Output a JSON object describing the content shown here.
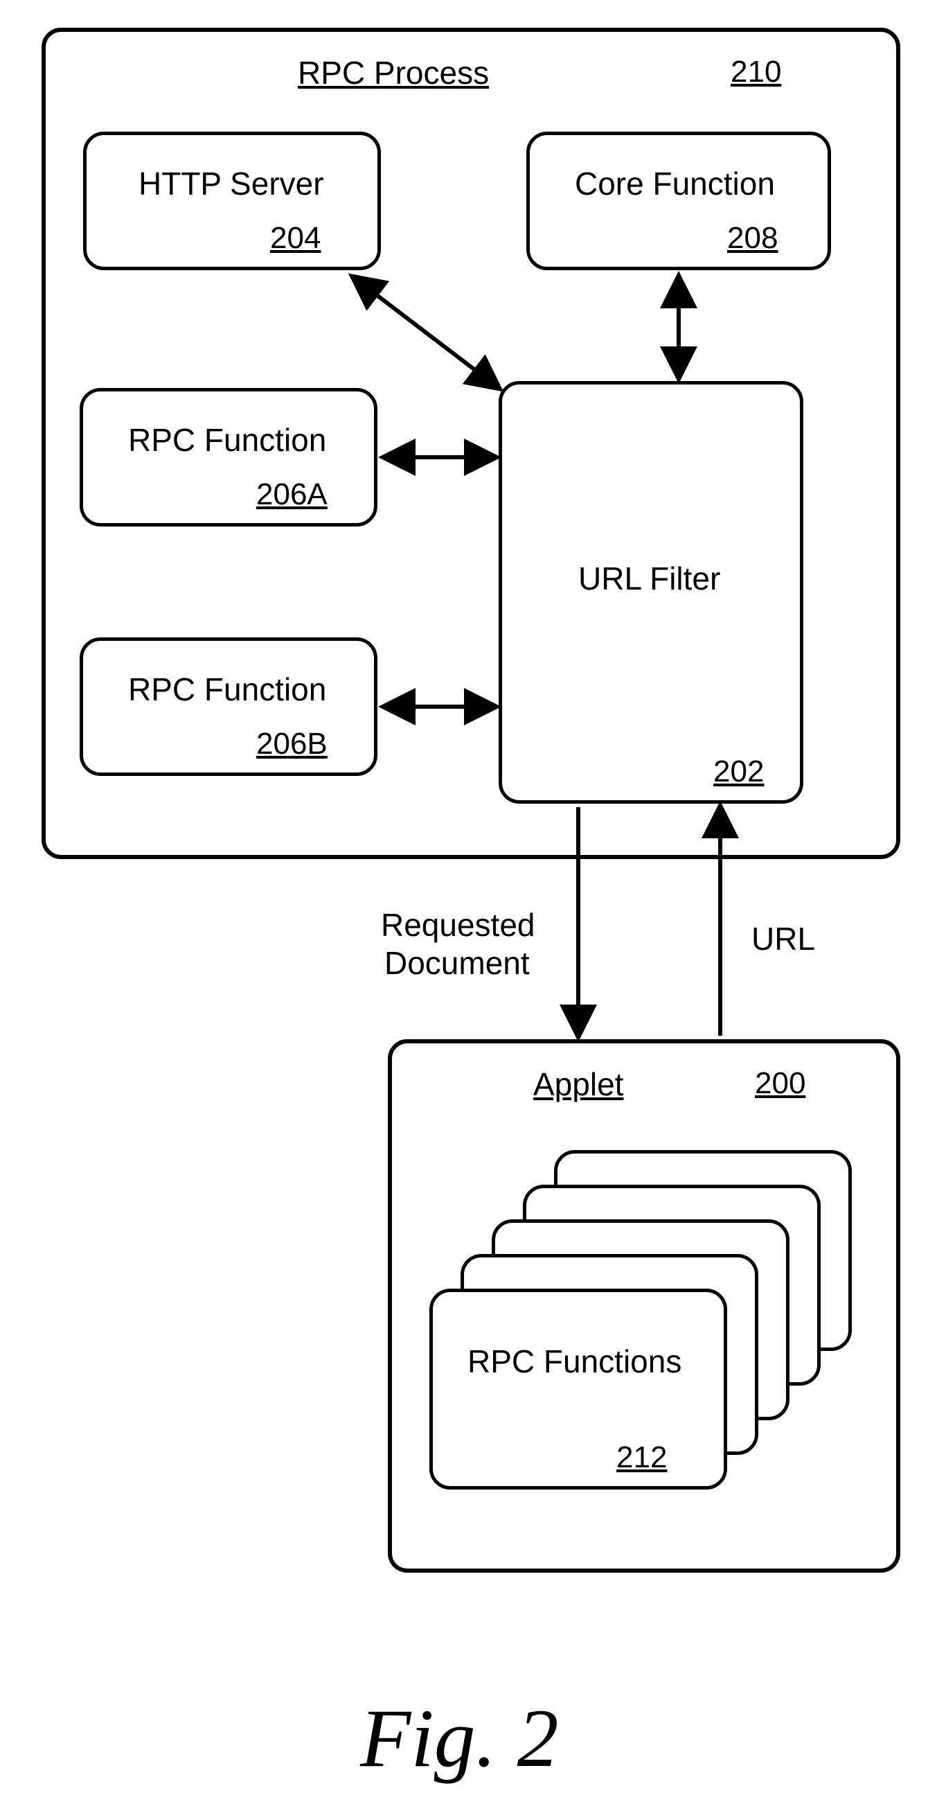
{
  "rpc_process": {
    "title": "RPC Process",
    "ref": "210"
  },
  "http_server": {
    "title": "HTTP Server",
    "ref": "204"
  },
  "core_function": {
    "title": "Core Function",
    "ref": "208"
  },
  "rpc_func_a": {
    "title": "RPC Function",
    "ref": "206A"
  },
  "url_filter": {
    "title": "URL Filter",
    "ref": "202"
  },
  "rpc_func_b": {
    "title": "RPC Function",
    "ref": "206B"
  },
  "requested_doc": {
    "line1": "Requested",
    "line2": "Document"
  },
  "url_label": "URL",
  "applet": {
    "title": "Applet",
    "ref": "200"
  },
  "rpc_functions": {
    "title": "RPC Functions",
    "ref": "212"
  },
  "figure_caption": "Fig. 2"
}
